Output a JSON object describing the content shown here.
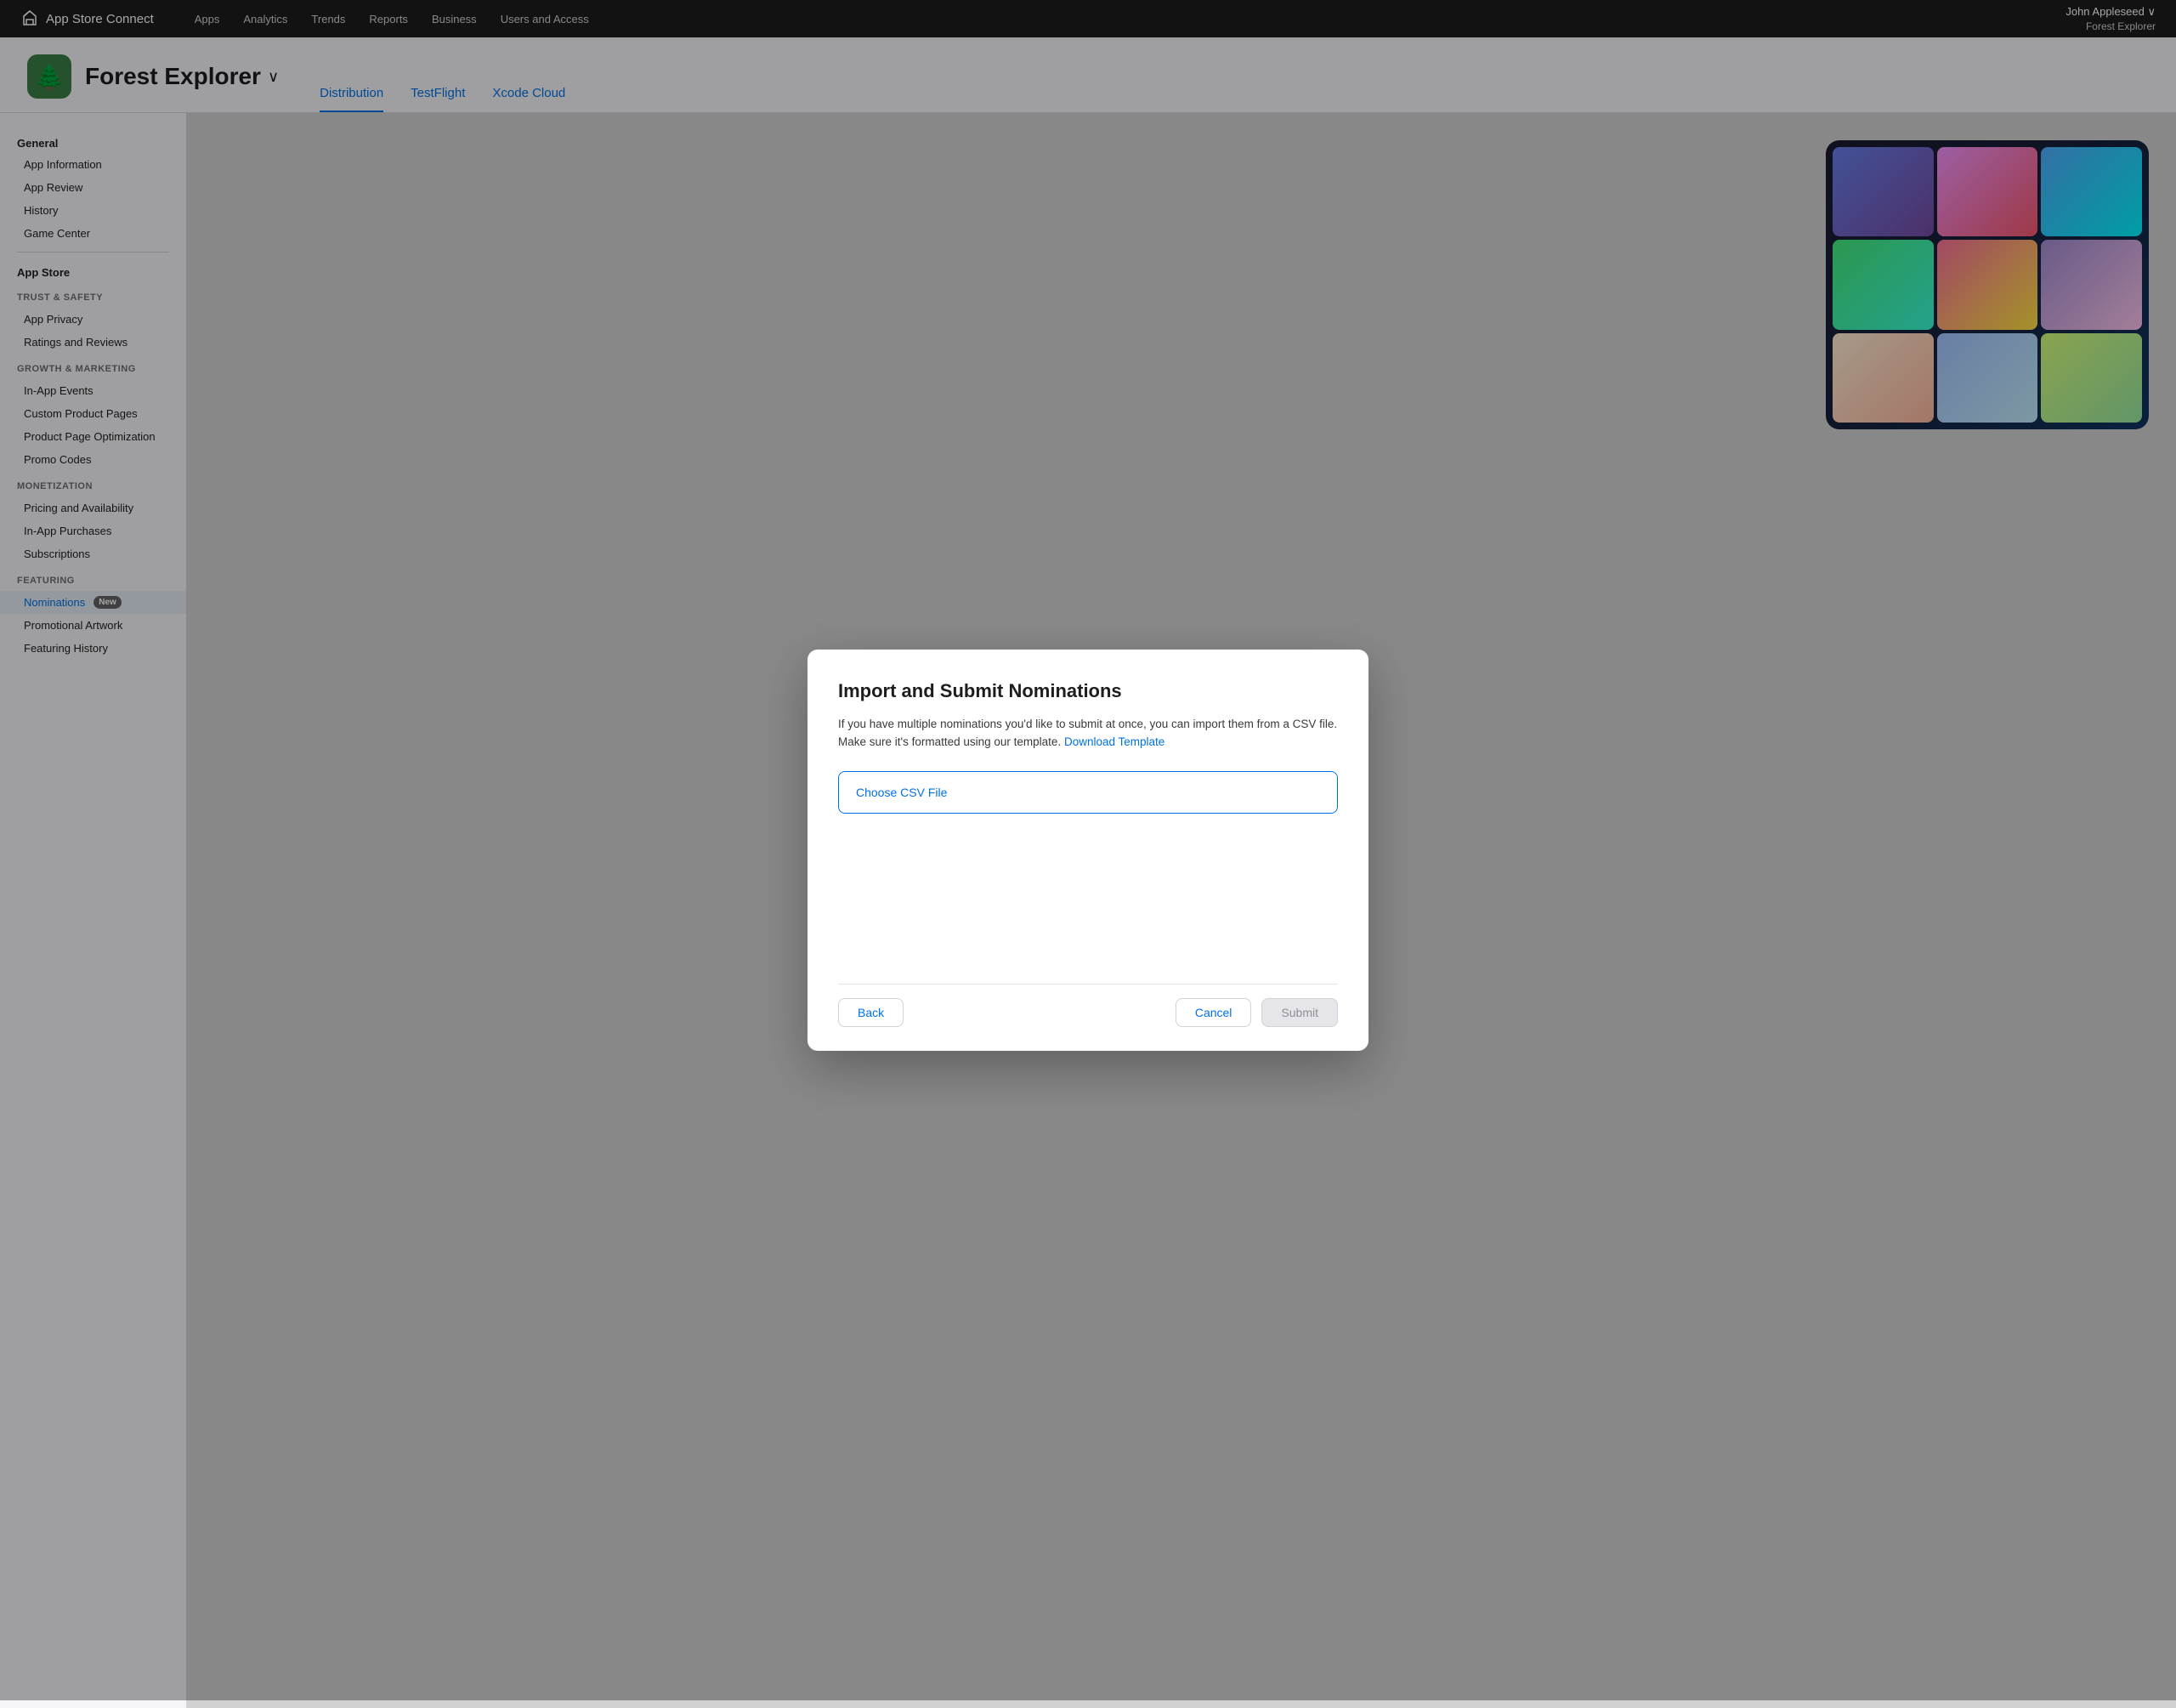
{
  "topnav": {
    "logo_icon": "🏔",
    "logo_text": "App Store Connect",
    "links": [
      "Apps",
      "Analytics",
      "Trends",
      "Reports",
      "Business",
      "Users and Access"
    ],
    "user_name": "John Appleseed ∨",
    "user_app": "Forest Explorer"
  },
  "app_header": {
    "app_icon": "🌲",
    "app_name": "Forest Explorer",
    "chevron": "∨",
    "tabs": [
      "Distribution",
      "TestFlight",
      "Xcode Cloud"
    ],
    "active_tab": "Distribution"
  },
  "sidebar": {
    "general_label": "General",
    "general_items": [
      "App Information",
      "App Review",
      "History",
      "Game Center"
    ],
    "app_store_label": "App Store",
    "trust_section": "TRUST & SAFETY",
    "trust_items": [
      "App Privacy",
      "Ratings and Reviews"
    ],
    "growth_section": "GROWTH & MARKETING",
    "growth_items": [
      "In-App Events",
      "Custom Product Pages",
      "Product Page Optimization",
      "Promo Codes"
    ],
    "monetization_section": "MONETIZATION",
    "monetization_items": [
      "Pricing and Availability",
      "In-App Purchases",
      "Subscriptions"
    ],
    "featuring_section": "FEATURING",
    "featuring_items": [
      "Nominations",
      "Promotional Artwork",
      "Featuring History"
    ],
    "nominations_badge": "New"
  },
  "modal": {
    "title": "Import and Submit Nominations",
    "description": "If you have multiple nominations you'd like to submit at once, you can import them from a CSV file. Make sure it's formatted using our template.",
    "download_link_text": "Download Template",
    "csv_button_label": "Choose CSV File",
    "back_label": "Back",
    "cancel_label": "Cancel",
    "submit_label": "Submit"
  }
}
